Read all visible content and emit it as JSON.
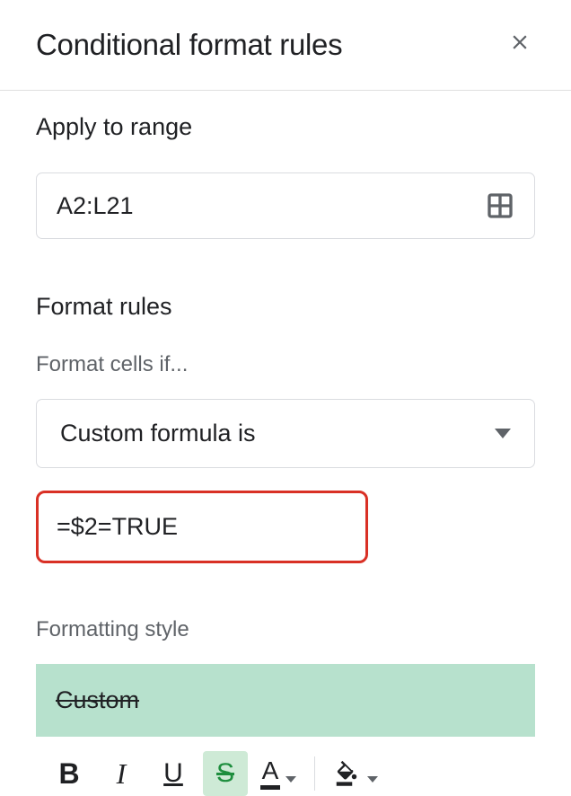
{
  "header": {
    "title": "Conditional format rules"
  },
  "range": {
    "section_title": "Apply to range",
    "value": "A2:L21"
  },
  "rules": {
    "section_title": "Format rules",
    "condition_label": "Format cells if...",
    "condition_selected": "Custom formula is",
    "formula_value": "=$2=TRUE"
  },
  "style": {
    "label": "Formatting style",
    "preview_text": "Custom",
    "preview_bg": "#b7e1cd",
    "strike_active": true
  }
}
